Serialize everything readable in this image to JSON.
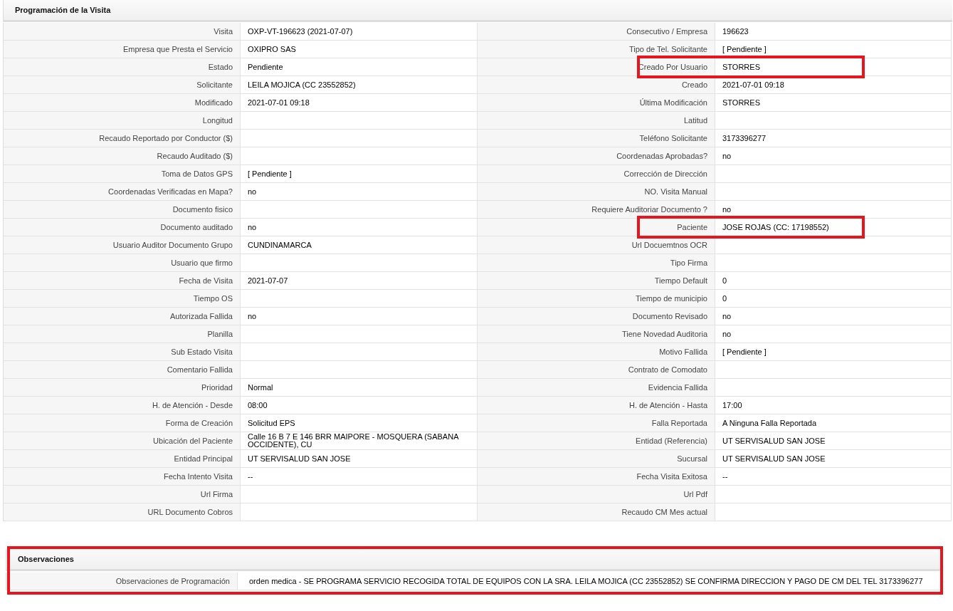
{
  "section": {
    "title": "Programación de la Visita"
  },
  "rows": [
    {
      "left": {
        "label": "Visita",
        "value": "OXP-VT-196623 (2021-07-07)",
        "highlighted": false
      },
      "right": {
        "label": "Consecutivo / Empresa",
        "value": "196623",
        "highlighted": false
      }
    },
    {
      "left": {
        "label": "Empresa que Presta el Servicio",
        "value": "OXIPRO SAS",
        "highlighted": false
      },
      "right": {
        "label": "Tipo de Tel. Solicitante",
        "value": "[ Pendiente ]",
        "highlighted": false
      }
    },
    {
      "left": {
        "label": "Estado",
        "value": "Pendiente",
        "highlighted": false
      },
      "right": {
        "label": "Creado Por Usuario",
        "value": "STORRES",
        "highlighted": true
      }
    },
    {
      "left": {
        "label": "Solicitante",
        "value": "LEILA MOJICA (CC 23552852)",
        "highlighted": false
      },
      "right": {
        "label": "Creado",
        "value": "2021-07-01 09:18",
        "highlighted": false
      }
    },
    {
      "left": {
        "label": "Modificado",
        "value": "2021-07-01 09:18",
        "highlighted": false
      },
      "right": {
        "label": "Última Modificación",
        "value": "STORRES",
        "highlighted": false
      }
    },
    {
      "left": {
        "label": "Longitud",
        "highlighted": false
      },
      "right": {
        "label": "Latitud",
        "highlighted": false
      }
    },
    {
      "left": {
        "label": "Recaudo Reportado por Conductor ($)",
        "highlighted": false
      },
      "right": {
        "label": "Teléfono Solicitante",
        "value": "3173396277",
        "highlighted": false
      }
    },
    {
      "left": {
        "label": "Recaudo Auditado ($)",
        "highlighted": false
      },
      "right": {
        "label": "Coordenadas Aprobadas?",
        "value": "no",
        "highlighted": false
      }
    },
    {
      "left": {
        "label": "Toma de Datos GPS",
        "value": "[ Pendiente ]",
        "highlighted": false
      },
      "right": {
        "label": "Corrección de Dirección",
        "highlighted": false
      }
    },
    {
      "left": {
        "label": "Coordenadas Verificadas en Mapa?",
        "value": "no",
        "highlighted": false
      },
      "right": {
        "label": "NO. Visita Manual",
        "highlighted": false
      }
    },
    {
      "left": {
        "label": "Documento fisico",
        "highlighted": false
      },
      "right": {
        "label": "Requiere Auditoriar Documento ?",
        "value": "no",
        "highlighted": false
      }
    },
    {
      "left": {
        "label": "Documento auditado",
        "value": "no",
        "highlighted": false
      },
      "right": {
        "label": "Paciente",
        "value": "JOSE ROJAS (CC: 17198552)",
        "highlighted": true
      }
    },
    {
      "left": {
        "label": "Usuario Auditor Documento Grupo",
        "value": "CUNDINAMARCA",
        "highlighted": false
      },
      "right": {
        "label": "Url Docuemtnos OCR",
        "highlighted": false
      }
    },
    {
      "left": {
        "label": "Usuario que firmo",
        "highlighted": false
      },
      "right": {
        "label": "Tipo Firma",
        "highlighted": false
      }
    },
    {
      "left": {
        "label": "Fecha de Visita",
        "value": "2021-07-07",
        "highlighted": false
      },
      "right": {
        "label": "Tiempo Default",
        "value": "0",
        "highlighted": false
      }
    },
    {
      "left": {
        "label": "Tiempo OS",
        "highlighted": false
      },
      "right": {
        "label": "Tiempo de municipio",
        "value": "0",
        "highlighted": false
      }
    },
    {
      "left": {
        "label": "Autorizada Fallida",
        "value": "no",
        "highlighted": false
      },
      "right": {
        "label": "Documento Revisado",
        "value": "no",
        "highlighted": false
      }
    },
    {
      "left": {
        "label": "Planilla",
        "highlighted": false
      },
      "right": {
        "label": "Tiene Novedad Auditoria",
        "value": "no",
        "highlighted": false
      }
    },
    {
      "left": {
        "label": "Sub Estado Visita",
        "highlighted": false
      },
      "right": {
        "label": "Motivo Fallida",
        "value": "[ Pendiente ]",
        "highlighted": false
      }
    },
    {
      "left": {
        "label": "Comentario Fallida",
        "highlighted": false
      },
      "right": {
        "label": "Contrato de Comodato",
        "highlighted": false
      }
    },
    {
      "left": {
        "label": "Prioridad",
        "value": "Normal",
        "highlighted": false
      },
      "right": {
        "label": "Evidencia Fallida",
        "highlighted": false
      }
    },
    {
      "left": {
        "label": "H. de Atención - Desde",
        "value": "08:00",
        "highlighted": false
      },
      "right": {
        "label": "H. de Atención - Hasta",
        "value": "17:00",
        "highlighted": false
      }
    },
    {
      "left": {
        "label": "Forma de Creación",
        "value": "Solicitud EPS",
        "highlighted": false
      },
      "right": {
        "label": "Falla Reportada",
        "value": "A Ninguna Falla Reportada",
        "highlighted": false
      }
    },
    {
      "left": {
        "label": "Ubicación del Paciente",
        "value": "Calle 16 B 7 E 146 BRR MAIPORE - MOSQUERA (SABANA OCCIDENTE), CU",
        "highlighted": false
      },
      "right": {
        "label": "Entidad (Referencia)",
        "value": "UT SERVISALUD SAN JOSE",
        "highlighted": false
      }
    },
    {
      "left": {
        "label": "Entidad Principal",
        "value": "UT SERVISALUD SAN JOSE",
        "highlighted": false
      },
      "right": {
        "label": "Sucursal",
        "value": "UT SERVISALUD SAN JOSE",
        "highlighted": false
      }
    },
    {
      "left": {
        "label": "Fecha Intento Visita",
        "value": "--",
        "highlighted": false
      },
      "right": {
        "label": "Fecha Visita Exitosa",
        "value": "--",
        "highlighted": false
      }
    },
    {
      "left": {
        "label": "Url Firma",
        "highlighted": false
      },
      "right": {
        "label": "Url Pdf",
        "highlighted": false
      }
    },
    {
      "left": {
        "label": "URL Documento Cobros",
        "highlighted": false
      },
      "right": {
        "label": "Recaudo CM Mes actual",
        "highlighted": false
      }
    }
  ],
  "observations": {
    "title": "Observaciones",
    "highlighted": true,
    "label": "Observaciones de Programación",
    "value": "orden medica - SE PROGRAMA SERVICIO RECOGIDA TOTAL DE EQUIPOS CON LA SRA. LEILA MOJICA (CC 23552852) SE CONFIRMA DIRECCION Y PAGO DE CM DEL TEL 3173396277"
  }
}
